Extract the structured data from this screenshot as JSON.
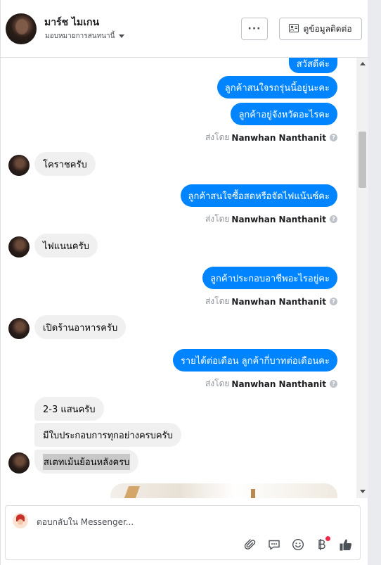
{
  "header": {
    "name": "มาร์ช ไมเกน",
    "subtitle": "มอบหมายการสนทนานี้",
    "more_label": "···",
    "contact_button_label": "ดูข้อมูลติดต่อ"
  },
  "messages": {
    "out1": "สวัสดีค่ะ",
    "out2": "ลูกค้าสนใจรถรุ่นนี้อยู่นะคะ",
    "out3": "ลูกค้าอยู่จังหวัดอะไรคะ",
    "in1": "โคราชครับ",
    "out4": "ลูกค้าสนใจซื้อสดหรือจัดไฟแน้นซ์คะ",
    "in2": "ไฟแนนครับ",
    "out5": "ลูกค้าประกอบอาชีพอะไรอยู่คะ",
    "in3": "เปิดร้านอาหารครับ",
    "out6": "รายได้ต่อเดือน ลูกค้ากี่บาทต่อเดือนคะ",
    "in4": "2-3 แสนครับ",
    "in5": "มีใบประกอบการทุกอย่างครบครับ",
    "in6": "สเตทเม้นย้อนหลังครบ"
  },
  "sent_by": {
    "prefix": "ส่งโดย",
    "name": "Nanwhan Nanthanit",
    "help": "?"
  },
  "composer": {
    "placeholder": "ตอบกลับใน Messenger...",
    "value": ""
  },
  "icons": {
    "attach": "paperclip-icon",
    "quick_reply": "chat-bubble-icon",
    "emoji": "smiley-icon",
    "payment": "baht-icon",
    "like": "thumbs-up-icon"
  },
  "colors": {
    "outgoing_bubble": "#0084ff",
    "incoming_bubble": "#f1f0f0",
    "notification_dot": "#f02849"
  }
}
